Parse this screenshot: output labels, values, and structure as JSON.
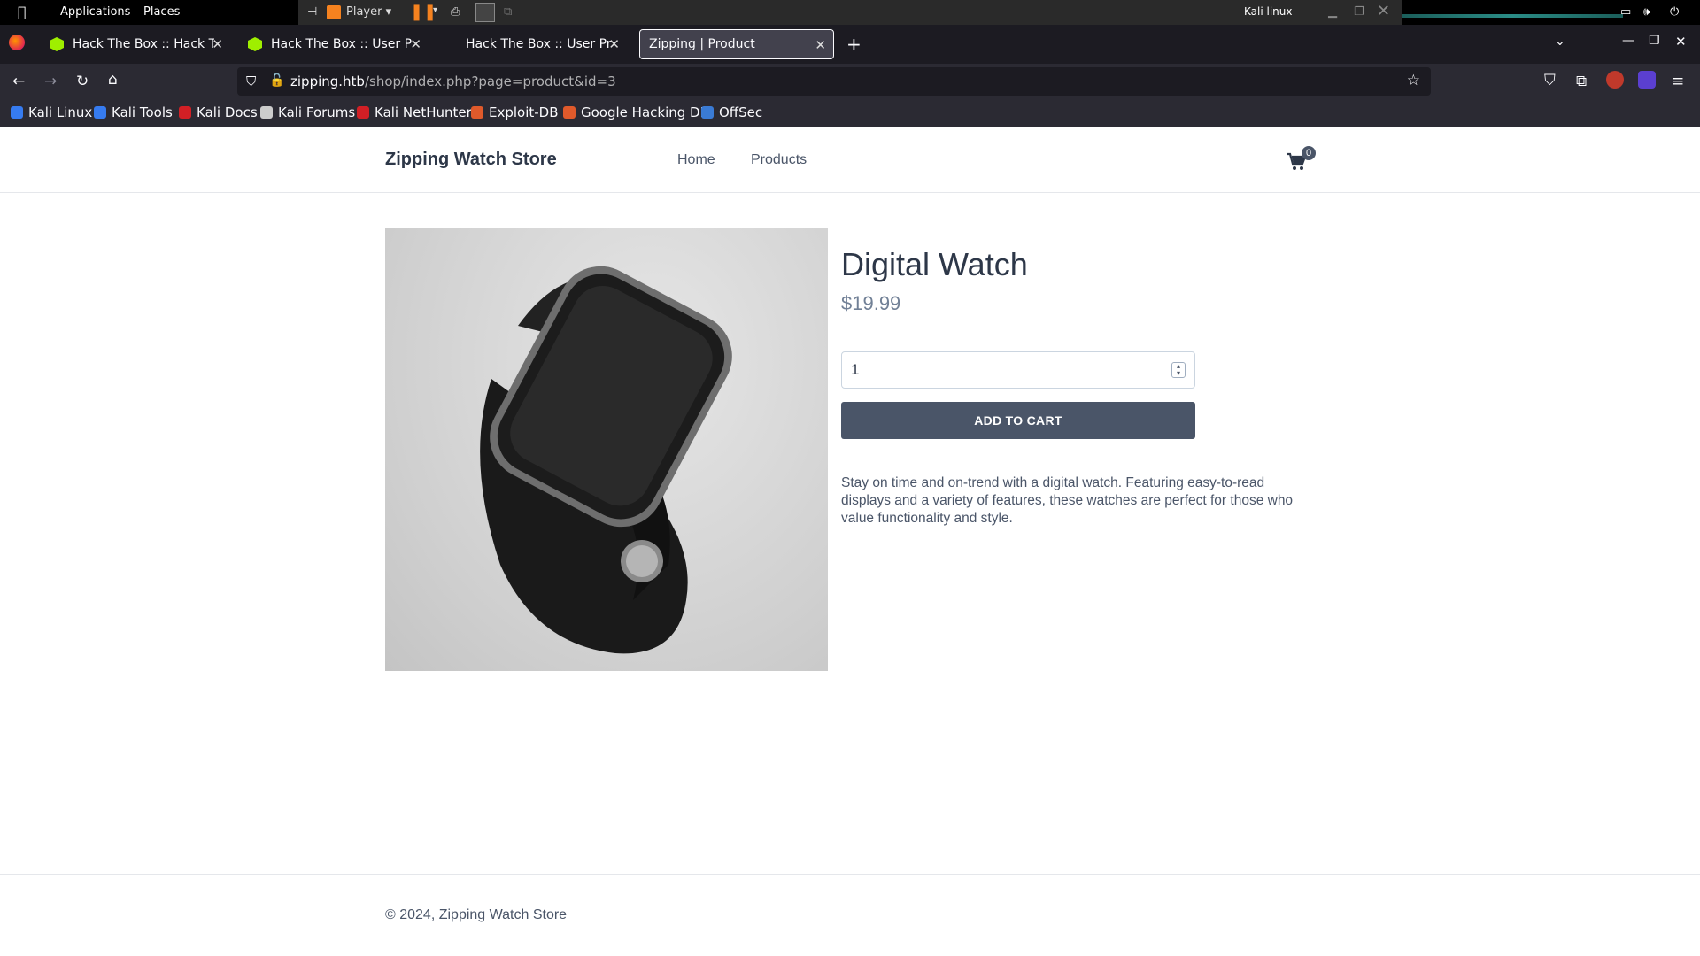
{
  "os": {
    "applications": "Applications",
    "places": "Places",
    "player": "Player",
    "host": "Kali linux",
    "colors": {
      "bar": "#000000",
      "vmbar": "#2a2a2a",
      "pause": "#f5821f"
    }
  },
  "browser": {
    "tabs": [
      {
        "title": "Hack The Box :: Hack The",
        "favicon": "htb-cube-icon",
        "active": false
      },
      {
        "title": "Hack The Box :: User Profi",
        "favicon": "htb-cube-icon",
        "active": false
      },
      {
        "title": "Hack The Box :: User Profi",
        "favicon": "",
        "active": false
      },
      {
        "title": "Zipping | Product",
        "favicon": "",
        "active": true
      }
    ],
    "url_host": "zipping.htb",
    "url_rest": "/shop/index.php?page=product&id=3",
    "bookmarks": [
      {
        "label": "Kali Linux",
        "icon": "kali-dragon-icon",
        "color": "#367bf0"
      },
      {
        "label": "Kali Tools",
        "icon": "kali-tools-icon",
        "color": "#367bf0"
      },
      {
        "label": "Kali Docs",
        "icon": "kali-docs-icon",
        "color": "#d21f25"
      },
      {
        "label": "Kali Forums",
        "icon": "kali-forums-icon",
        "color": "#cccccc"
      },
      {
        "label": "Kali NetHunter",
        "icon": "nethunter-icon",
        "color": "#d21f25"
      },
      {
        "label": "Exploit-DB",
        "icon": "exploit-db-icon",
        "color": "#e05a2b"
      },
      {
        "label": "Google Hacking DB",
        "icon": "ghdb-icon",
        "color": "#e05a2b"
      },
      {
        "label": "OffSec",
        "icon": "offsec-icon",
        "color": "#3a7bd5"
      }
    ],
    "colors": {
      "tabstrip": "#1c1b22",
      "toolbar": "#2b2a33",
      "urlbar": "#1c1b22",
      "active_tab": "#42414d"
    }
  },
  "site": {
    "brand": "Zipping Watch Store",
    "nav": {
      "home": "Home",
      "products": "Products"
    },
    "cart_count": "0",
    "product": {
      "title": "Digital Watch",
      "price": "$19.99",
      "quantity": "1",
      "add_to_cart": "ADD TO CART",
      "description": "Stay on time and on-trend with a digital watch. Featuring easy-to-read displays and a variety of features, these watches are perfect for those who value functionality and style."
    },
    "footer": "© 2024, Zipping Watch Store",
    "colors": {
      "text": "#2d3748",
      "muted": "#718096",
      "button": "#4a5568"
    }
  }
}
